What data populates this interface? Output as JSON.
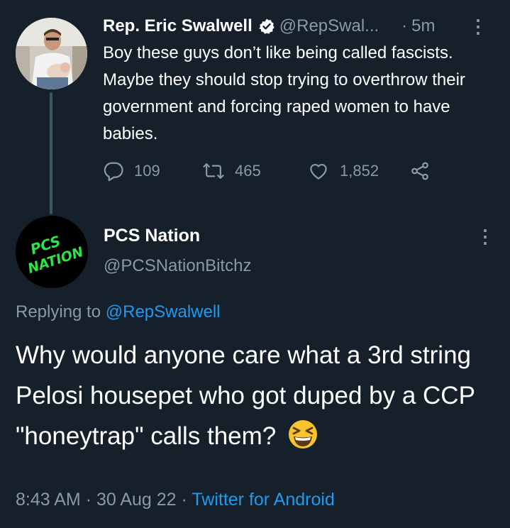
{
  "original_tweet": {
    "author_name": "Rep. Eric Swalwell",
    "handle": "@RepSwal...",
    "separator": "·",
    "time": "5m",
    "text": "Boy these guys don’t like being called fascists. Maybe they should stop trying to overthrow their government and forcing raped women to have babies.",
    "replies": "109",
    "retweets": "465",
    "likes": "1,852"
  },
  "reply_tweet": {
    "author_name": "PCS Nation",
    "handle": "@PCSNationBitchz",
    "avatar_text": "PCS NATION",
    "replying_label": "Replying to",
    "replying_to": "@RepSwalwell",
    "text": "Why would anyone care what a 3rd string Pelosi housepet who got duped by a CCP \"honeytrap\" calls them?",
    "emoji": "grinning-squinting-face",
    "time": "8:43 AM",
    "date": "30 Aug 22",
    "separator": "·",
    "source": "Twitter for Android"
  },
  "colors": {
    "background": "#15202b",
    "secondary_text": "#8b98a5",
    "link": "#1d9bf0",
    "avatar_text": "#2ce34a"
  }
}
